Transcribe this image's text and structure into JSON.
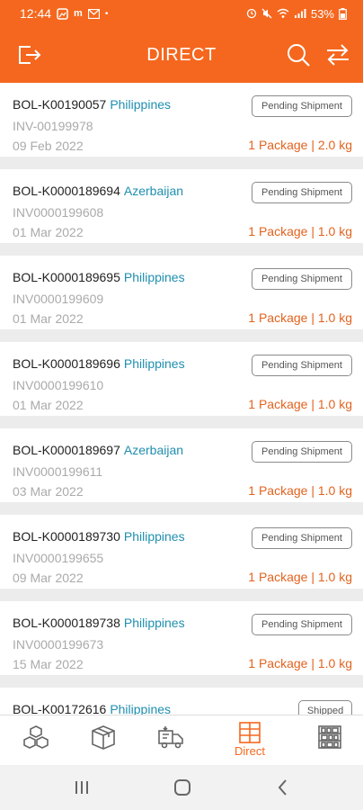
{
  "status_bar": {
    "time": "12:44",
    "battery": "53%"
  },
  "header": {
    "title": "DIRECT"
  },
  "shipments": [
    {
      "bol": "BOL-K00190057",
      "country": "Philippines",
      "invoice": "INV-00199978",
      "date": "09 Feb 2022",
      "status": "Pending Shipment",
      "package": "1 Package | 2.0 kg"
    },
    {
      "bol": "BOL-K0000189694",
      "country": "Azerbaijan",
      "invoice": "INV0000199608",
      "date": "01 Mar 2022",
      "status": "Pending Shipment",
      "package": "1 Package | 1.0 kg"
    },
    {
      "bol": "BOL-K0000189695",
      "country": "Philippines",
      "invoice": "INV0000199609",
      "date": "01 Mar 2022",
      "status": "Pending Shipment",
      "package": "1 Package | 1.0 kg"
    },
    {
      "bol": "BOL-K0000189696",
      "country": "Philippines",
      "invoice": "INV0000199610",
      "date": "01 Mar 2022",
      "status": "Pending Shipment",
      "package": "1 Package | 1.0 kg"
    },
    {
      "bol": "BOL-K0000189697",
      "country": "Azerbaijan",
      "invoice": "INV0000199611",
      "date": "03 Mar 2022",
      "status": "Pending Shipment",
      "package": "1 Package | 1.0 kg"
    },
    {
      "bol": "BOL-K0000189730",
      "country": "Philippines",
      "invoice": "INV0000199655",
      "date": "09 Mar 2022",
      "status": "Pending Shipment",
      "package": "1 Package | 1.0 kg"
    },
    {
      "bol": "BOL-K0000189738",
      "country": "Philippines",
      "invoice": "INV0000199673",
      "date": "15 Mar 2022",
      "status": "Pending Shipment",
      "package": "1 Package | 1.0 kg"
    },
    {
      "bol": "BOL-K00172616",
      "country": "Philippines",
      "invoice": "",
      "date": "",
      "status": "Shipped",
      "package": ""
    }
  ],
  "bottom_nav": {
    "items": [
      {
        "icon": "boxes-icon",
        "label": ""
      },
      {
        "icon": "package-icon",
        "label": ""
      },
      {
        "icon": "delivery-truck-icon",
        "label": ""
      },
      {
        "icon": "direct-grid-icon",
        "label": "Direct",
        "active": true
      },
      {
        "icon": "shelves-icon",
        "label": ""
      }
    ]
  },
  "colors": {
    "brand": "#f5671e",
    "country_link": "#1f8fb0",
    "package_text": "#e2631f"
  }
}
